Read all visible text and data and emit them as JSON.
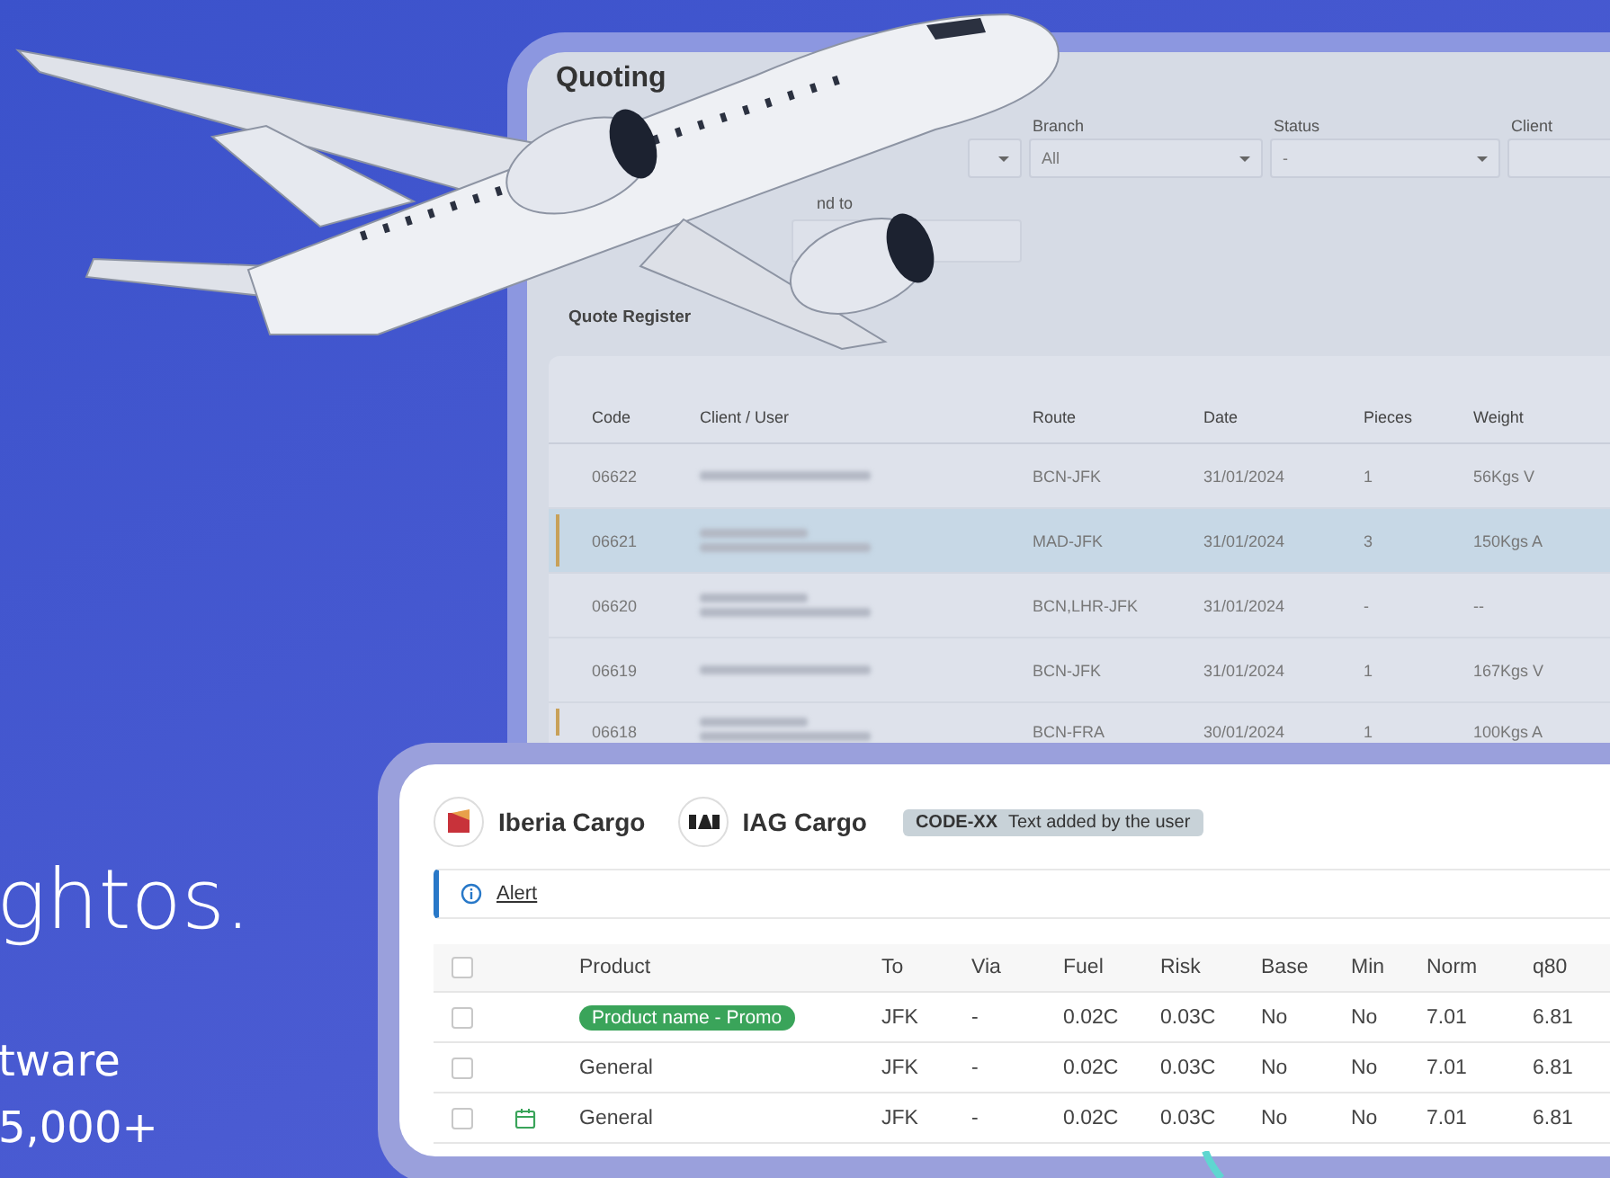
{
  "hero": {
    "headline": "ghtos.",
    "subtitle_lines": [
      "tware",
      "5,000+"
    ]
  },
  "quoting_panel": {
    "title": "Quoting",
    "filters": [
      {
        "kind": "select"
      },
      {
        "kind": "select",
        "label": "Branch",
        "value": "All"
      },
      {
        "kind": "select",
        "label": "Status",
        "value": "-"
      },
      {
        "kind": "input",
        "label": "Client"
      }
    ],
    "second_filter": {
      "label": "nd to"
    },
    "section_title": "Quote Register",
    "table": {
      "columns": [
        "Code",
        "Client / User",
        "Route",
        "Date",
        "Pieces",
        "Weight"
      ],
      "rows": [
        {
          "code": "06622",
          "route": "BCN-JFK",
          "date": "31/01/2024",
          "pieces": "1",
          "weight": "56Kgs V",
          "flagged": false,
          "selected": false
        },
        {
          "code": "06621",
          "route": "MAD-JFK",
          "date": "31/01/2024",
          "pieces": "3",
          "weight": "150Kgs A",
          "flagged": true,
          "selected": true
        },
        {
          "code": "06620",
          "route": "BCN,LHR-JFK",
          "date": "31/01/2024",
          "pieces": "-",
          "weight": "--",
          "flagged": false,
          "selected": false
        },
        {
          "code": "06619",
          "route": "BCN-JFK",
          "date": "31/01/2024",
          "pieces": "1",
          "weight": "167Kgs V",
          "flagged": false,
          "selected": false
        },
        {
          "code": "06618",
          "route": "BCN-FRA",
          "date": "30/01/2024",
          "pieces": "1",
          "weight": "100Kgs A",
          "flagged": true,
          "selected": false
        }
      ]
    }
  },
  "rates_card": {
    "carriers": [
      {
        "kind": "iberia",
        "name": "Iberia Cargo"
      },
      {
        "kind": "iag",
        "name": "IAG Cargo"
      }
    ],
    "tag": {
      "code": "CODE-XX",
      "text": "Text added by the user"
    },
    "alert": {
      "text": "Alert"
    },
    "table": {
      "columns": [
        "Product",
        "To",
        "Via",
        "Fuel",
        "Risk",
        "Base",
        "Min",
        "Norm",
        "q80"
      ],
      "header_checked": false,
      "rows": [
        {
          "kind": "promo",
          "scheduled": false,
          "checked": false,
          "cells": [
            "Product name - Promo",
            "JFK",
            "-",
            "0.02C",
            "0.03C",
            "No",
            "No",
            "7.01",
            "6.81"
          ]
        },
        {
          "kind": "plain",
          "scheduled": false,
          "checked": false,
          "cells": [
            "General",
            "JFK",
            "-",
            "0.02C",
            "0.03C",
            "No",
            "No",
            "7.01",
            "6.81"
          ]
        },
        {
          "kind": "plain",
          "scheduled": true,
          "checked": false,
          "cells": [
            "General",
            "JFK",
            "-",
            "0.02C",
            "0.03C",
            "No",
            "No",
            "7.01",
            "6.81"
          ]
        }
      ]
    }
  }
}
